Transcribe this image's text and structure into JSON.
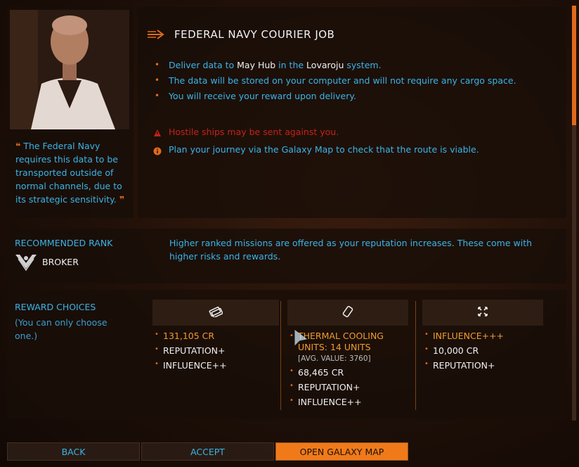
{
  "header": {
    "title": "FEDERAL NAVY COURIER JOB"
  },
  "description": [
    {
      "pre": "Deliver data to ",
      "place": "May Hub",
      "mid": " in the ",
      "system": "Lovaroju",
      "post": " system."
    },
    {
      "text": "The data will be stored on your computer and will not require any cargo space."
    },
    {
      "text": "You will receive your reward upon delivery."
    }
  ],
  "warnings": {
    "hostile": "Hostile ships may be sent against you.",
    "plan": "Plan your journey via the Galaxy Map to check that the route is viable."
  },
  "quote": "The Federal Navy requires this data to be transported outside of normal channels, due to its strategic sensitivity.",
  "rank": {
    "label": "RECOMMENDED RANK",
    "value": "BROKER",
    "note": "Higher ranked missions are offered as your reputation increases. These come with higher risks and rewards."
  },
  "rewards": {
    "label": "REWARD CHOICES",
    "sub": "(You can only choose one.)",
    "choice1": [
      "131,105 CR",
      "REPUTATION+",
      "INFLUENCE++"
    ],
    "choice2": {
      "item": "THERMAL COOLING UNITS: 14 UNITS",
      "avg": "[AVG. VALUE: 3760]",
      "rest": [
        "68,465 CR",
        "REPUTATION+",
        "INFLUENCE++"
      ]
    },
    "choice3": [
      "INFLUENCE+++",
      "10,000 CR",
      "REPUTATION+"
    ]
  },
  "buttons": {
    "back": "BACK",
    "accept": "ACCEPT",
    "galaxy": "OPEN GALAXY MAP"
  },
  "colors": {
    "accent": "#f07a1a",
    "info": "#3ab4e6",
    "warning": "#c4221a"
  }
}
